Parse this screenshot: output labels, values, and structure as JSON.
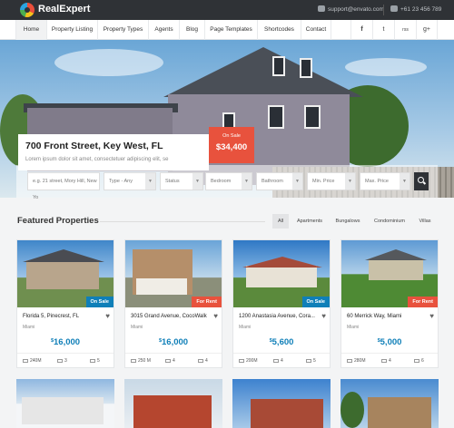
{
  "brand": {
    "name": "RealExpert"
  },
  "topbar": {
    "email": "support@envato.com",
    "phone": "+61 23 456 789"
  },
  "nav": {
    "items": [
      "Home",
      "Property Listing",
      "Property Types",
      "Agents",
      "Blog",
      "Page Templates",
      "Shortcodes",
      "Contact"
    ],
    "social": [
      "f",
      "t",
      "rss",
      "g+"
    ]
  },
  "hero": {
    "address": "700 Front Street, Key West, FL",
    "subtitle": "Lorem ipsum dolor sit amet, consectetuer adipiscing elit, se",
    "status": "On Sale",
    "price": "$34,400"
  },
  "search": {
    "placeholder": "e.g. 21 street, Mory Hill, New Yo",
    "type": "Type - Any",
    "status": "Status",
    "bedroom": "Bedroom",
    "bathroom": "Bathroom",
    "min_price": "Min. Price",
    "max_price": "Max. Price"
  },
  "featured": {
    "title": "Featured Properties",
    "filters": [
      "All",
      "Apartments",
      "Bungalows",
      "Condominium",
      "Villas"
    ]
  },
  "colors": {
    "accent": "#e8523d",
    "sale_badge": "#0f7fb8",
    "price": "#0f7fb8",
    "dark": "#2f3236"
  },
  "cards": [
    {
      "title": "Florida 5, Pinecrest, FL",
      "city": "Miami",
      "price": "16,000",
      "badge": "On Sale",
      "badge_color": "#0f7fb8",
      "area": "240M",
      "beds": "3",
      "baths": "5"
    },
    {
      "title": "3015 Grand Avenue, CocoWalk",
      "city": "Miami",
      "price": "16,000",
      "badge": "For Rent",
      "badge_color": "#e8523d",
      "area": "250 M",
      "beds": "4",
      "baths": "4"
    },
    {
      "title": "1200 Anastasia Avenue, Cora...",
      "city": "Miami",
      "price": "5,600",
      "badge": "On Sale",
      "badge_color": "#0f7fb8",
      "area": "200M",
      "beds": "4",
      "baths": "5"
    },
    {
      "title": "60 Merrick Way, Miami",
      "city": "Miami",
      "price": "5,000",
      "badge": "For Rent",
      "badge_color": "#e8523d",
      "area": "280M",
      "beds": "4",
      "baths": "6"
    }
  ]
}
